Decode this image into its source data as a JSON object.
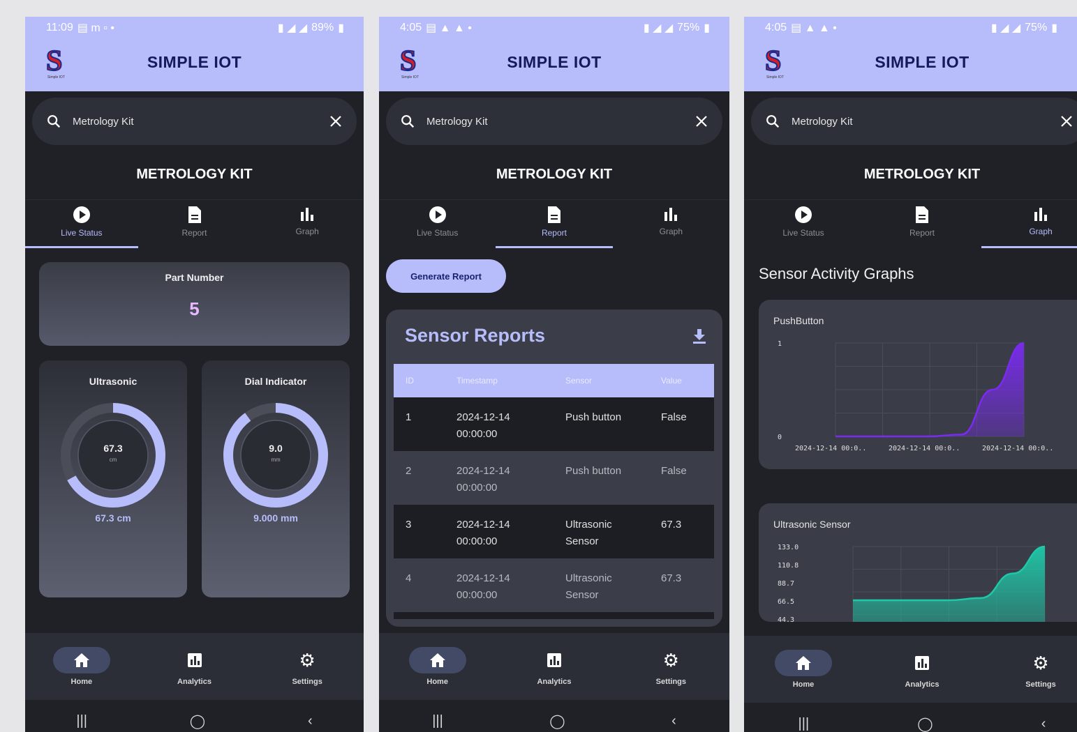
{
  "phones": [
    {
      "status": {
        "time": "11:09",
        "icons_left": "▤ m ▫ •",
        "battery": "89%"
      },
      "app_title": "SIMPLE IOT",
      "logo_tagline": "Simple IOT",
      "search": {
        "value": "Metrology Kit"
      },
      "kit_title": "METROLOGY KIT",
      "tabs": [
        "Live Status",
        "Report",
        "Graph"
      ],
      "active_tab": 0,
      "part": {
        "label": "Part Number",
        "value": "5"
      },
      "gauges": [
        {
          "title": "Ultrasonic",
          "value": "67.3",
          "unit": "cm",
          "reading": "67.3 cm",
          "fraction": 0.67
        },
        {
          "title": "Dial Indicator",
          "value": "9.0",
          "unit": "mm",
          "reading": "9.000 mm",
          "fraction": 0.9
        }
      ],
      "nav": [
        "Home",
        "Analytics",
        "Settings"
      ]
    },
    {
      "status": {
        "time": "4:05",
        "icons_left": "▤ ▲ ▲ •",
        "battery": "75%"
      },
      "app_title": "SIMPLE IOT",
      "logo_tagline": "Simple IOT",
      "search": {
        "value": "Metrology Kit"
      },
      "kit_title": "METROLOGY KIT",
      "tabs": [
        "Live Status",
        "Report",
        "Graph"
      ],
      "active_tab": 1,
      "generate_button": "Generate Report",
      "reports": {
        "title": "Sensor Reports",
        "columns": [
          "ID",
          "Timestamp",
          "Sensor",
          "Value"
        ],
        "rows": [
          {
            "id": "1",
            "date": "2024-12-14",
            "time": "00:00:00",
            "sensor1": "Push button",
            "sensor2": "",
            "value": "False"
          },
          {
            "id": "2",
            "date": "2024-12-14",
            "time": "00:00:00",
            "sensor1": "Push button",
            "sensor2": "",
            "value": "False"
          },
          {
            "id": "3",
            "date": "2024-12-14",
            "time": "00:00:00",
            "sensor1": "Ultrasonic",
            "sensor2": "Sensor",
            "value": "67.3"
          },
          {
            "id": "4",
            "date": "2024-12-14",
            "time": "00:00:00",
            "sensor1": "Ultrasonic",
            "sensor2": "Sensor",
            "value": "67.3"
          }
        ]
      },
      "nav": [
        "Home",
        "Analytics",
        "Settings"
      ]
    },
    {
      "status": {
        "time": "4:05",
        "icons_left": "▤ ▲ ▲ •",
        "battery": "75%"
      },
      "app_title": "SIMPLE IOT",
      "logo_tagline": "Simple IOT",
      "search": {
        "value": "Metrology Kit"
      },
      "kit_title": "METROLOGY KIT",
      "tabs": [
        "Live Status",
        "Report",
        "Graph"
      ],
      "active_tab": 2,
      "graphs_title": "Sensor Activity Graphs",
      "nav": [
        "Home",
        "Analytics",
        "Settings"
      ]
    }
  ],
  "colors": {
    "accent": "#b7bcfb",
    "background": "#1f2127",
    "purple": "#7a2bf0",
    "teal": "#1fc8a8"
  },
  "chart_data": [
    {
      "type": "area",
      "title": "PushButton",
      "x": [
        "2024-12-14 00:0..",
        "2024-12-14 00:0..",
        "2024-12-14 00:0.."
      ],
      "yticks": [
        "0",
        "1"
      ],
      "ylim": [
        0,
        1
      ],
      "series": [
        {
          "values": [
            0,
            0,
            0,
            0,
            0.02,
            0.5,
            1
          ]
        }
      ]
    },
    {
      "type": "area",
      "title": "Ultrasonic Sensor",
      "yticks": [
        "133.0",
        "110.8",
        "88.7",
        "66.5",
        "44.3"
      ],
      "ylim": [
        22.1,
        133.0
      ],
      "series": [
        {
          "values": [
            67.3,
            67.3,
            67.3,
            67.3,
            70,
            100,
            133
          ]
        }
      ]
    }
  ]
}
